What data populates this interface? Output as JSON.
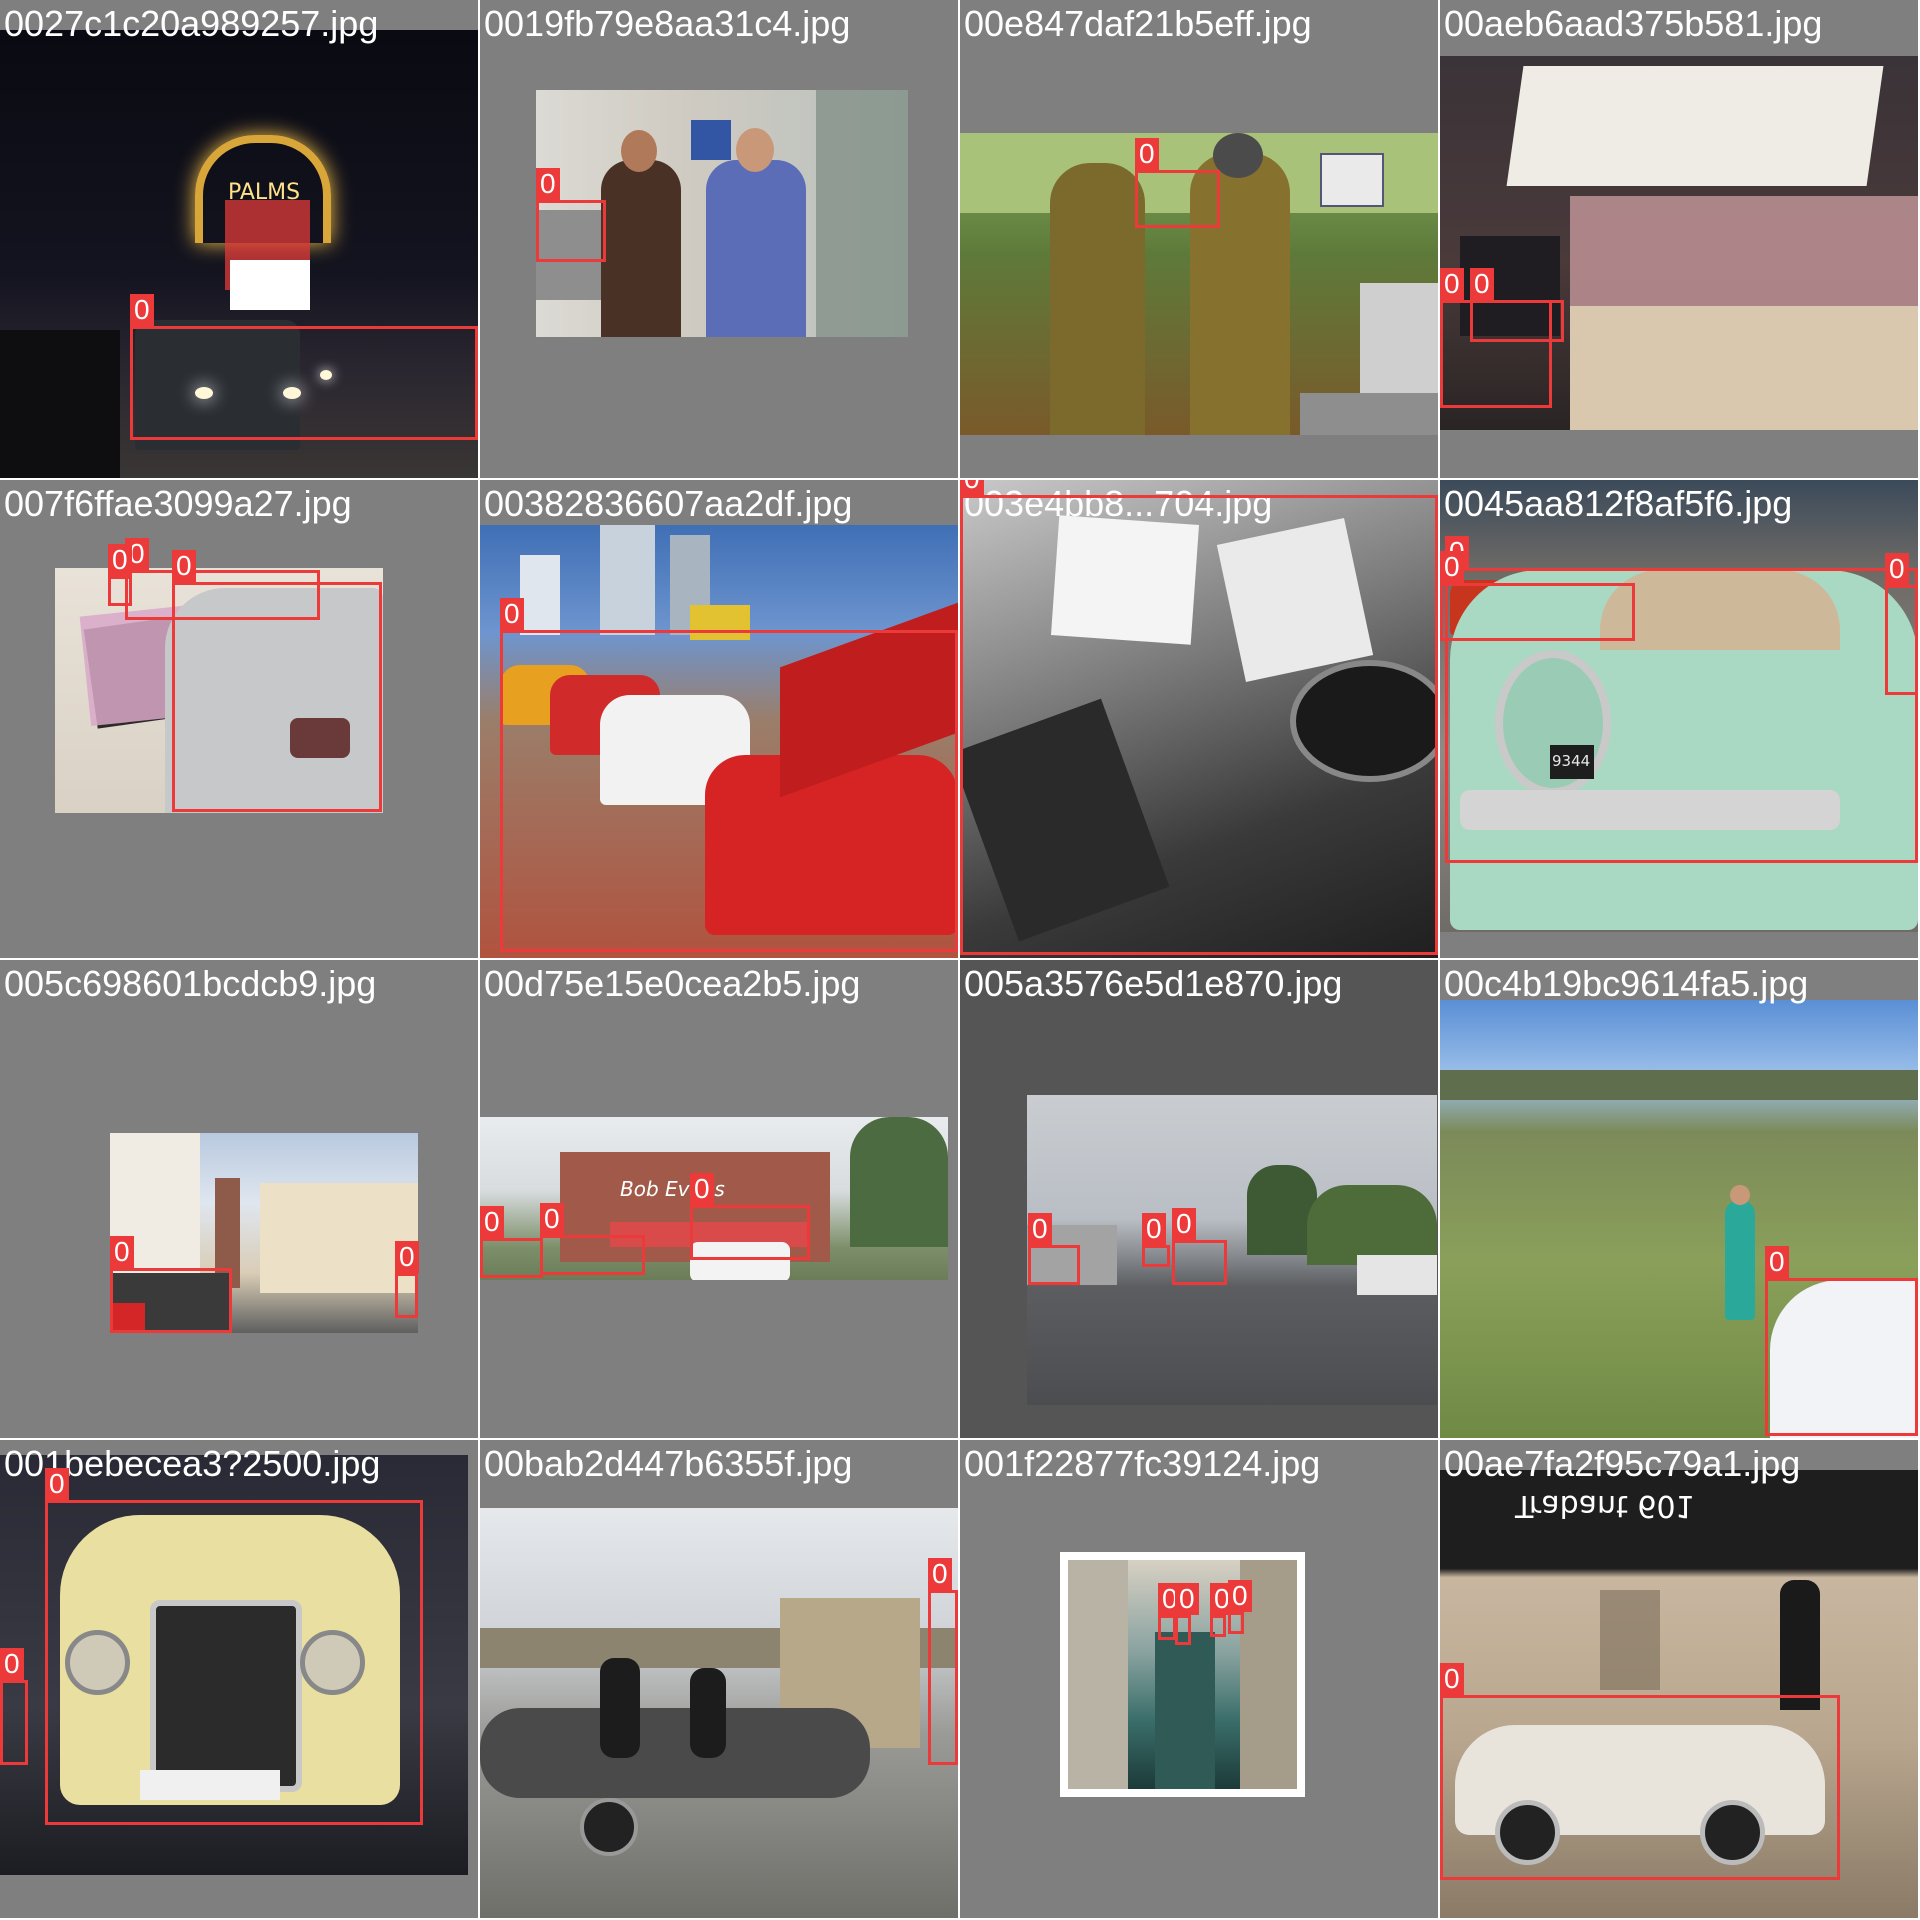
{
  "grid": {
    "tiles": [
      {
        "filename": "0027c1c20a989257.jpg",
        "detections": [
          {
            "label": "0"
          }
        ]
      },
      {
        "filename": "0019fb79e8aa31c4.jpg",
        "detections": [
          {
            "label": "0"
          }
        ]
      },
      {
        "filename": "00e847daf21b5eff.jpg",
        "detections": [
          {
            "label": "0"
          }
        ]
      },
      {
        "filename": "00aeb6aad375b581.jpg",
        "detections": [
          {
            "label": "0"
          },
          {
            "label": "0"
          }
        ]
      },
      {
        "filename": "007f6ffae3099a27.jpg",
        "detections": [
          {
            "label": "0"
          },
          {
            "label": "0"
          },
          {
            "label": "0"
          }
        ]
      },
      {
        "filename": "00382836607aa2df.jpg",
        "detections": [
          {
            "label": "0"
          }
        ]
      },
      {
        "filename": "003e4bb8...704.jpg",
        "detections": [
          {
            "label": "0"
          }
        ]
      },
      {
        "filename": "0045aa812f8af5f6.jpg",
        "detections": [
          {
            "label": "0"
          },
          {
            "label": "0"
          },
          {
            "label": "0"
          }
        ]
      },
      {
        "filename": "005c698601bcdcb9.jpg",
        "detections": [
          {
            "label": "0"
          },
          {
            "label": "0"
          }
        ]
      },
      {
        "filename": "00d75e15e0cea2b5.jpg",
        "detections": [
          {
            "label": "0"
          },
          {
            "label": "0"
          },
          {
            "label": "0"
          }
        ]
      },
      {
        "filename": "005a3576e5d1e870.jpg",
        "detections": [
          {
            "label": "0"
          },
          {
            "label": "0"
          },
          {
            "label": "0"
          }
        ]
      },
      {
        "filename": "00c4b19bc9614fa5.jpg",
        "detections": [
          {
            "label": "0"
          }
        ]
      },
      {
        "filename": "001bebecea3?2500.jpg",
        "detections": [
          {
            "label": "0"
          },
          {
            "label": "0"
          }
        ]
      },
      {
        "filename": "00bab2d447b6355f.jpg",
        "detections": [
          {
            "label": "0"
          }
        ]
      },
      {
        "filename": "001f22877fc39124.jpg",
        "detections": [
          {
            "label": "0"
          },
          {
            "label": "0"
          },
          {
            "label": "0"
          },
          {
            "label": "0"
          }
        ]
      },
      {
        "filename": "00ae7fa2f95c79a1.jpg",
        "detections": [
          {
            "label": "0"
          }
        ]
      }
    ]
  },
  "scene_text": {
    "palms_sign": "PALMS",
    "bob_evans_sign": "Bob Evans",
    "plate_9344": "9344",
    "trabant_sign": "Trabant 601"
  },
  "colors": {
    "tile_bg": "#7f7f7f",
    "box": "#ec3a3a",
    "filename_text": "#ffffff"
  }
}
